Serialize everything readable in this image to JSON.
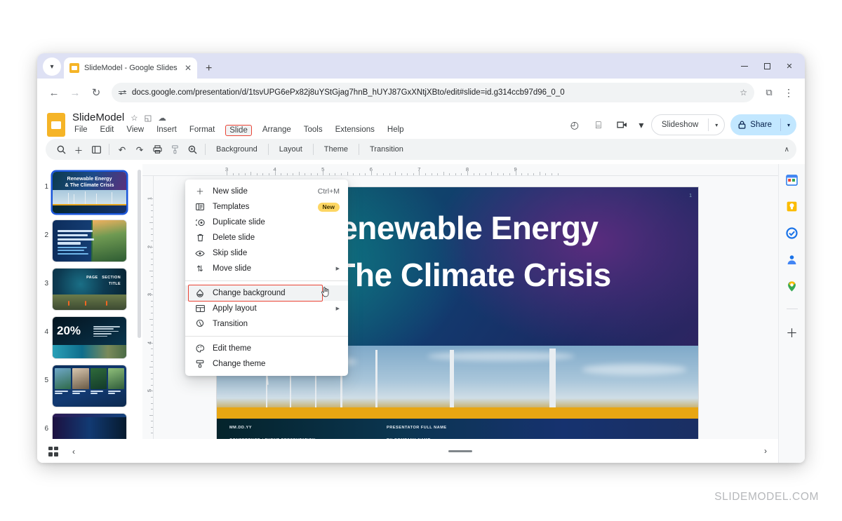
{
  "browser": {
    "tab": {
      "title": "SlideModel - Google Slides",
      "close_label": "✕",
      "newtab_label": "+"
    },
    "tab_list_chevron": "▾",
    "window_controls": {
      "minimize": "—",
      "maximize": "❐",
      "close": "✕"
    },
    "nav": {
      "back": "←",
      "forward": "→",
      "reload": "↻"
    },
    "url": "docs.google.com/presentation/d/1tsvUPG6ePx82j8uYStGjag7hnB_hUYJ87GxXNtjXBto/edit#slide=id.g314ccb97d96_0_0",
    "bookmark_star": "☆",
    "extensions": "⧉",
    "menu_kebab": "⋮"
  },
  "app": {
    "doc_title": "SlideModel",
    "title_icons": [
      "star-icon",
      "move-to-folder-icon",
      "cloud-saved-icon"
    ],
    "title_icon_glyphs": [
      "☆",
      "◱",
      "☁"
    ],
    "menubar": [
      "File",
      "Edit",
      "View",
      "Insert",
      "Format",
      "Slide",
      "Arrange",
      "Tools",
      "Extensions",
      "Help"
    ],
    "active_menu": "Slide",
    "header_right": {
      "version_history": "◴",
      "comments": "⌸",
      "meet": "▷",
      "meet_caret": "▾",
      "slideshow_label": "Slideshow",
      "slideshow_caret": "▾",
      "share_label": "Share",
      "share_lock": "⚿",
      "share_caret": "▾"
    },
    "toolbar": {
      "icons": [
        "search-icon",
        "add-slide-icon",
        "layout-icon",
        "undo-icon",
        "redo-icon",
        "print-icon",
        "paint-format-icon",
        "zoom-icon"
      ],
      "icon_glyphs": [
        "⌕",
        "＋",
        "▤",
        "↶",
        "↷",
        "⎙",
        "✒",
        "⌕"
      ],
      "text_items": [
        "Background",
        "Layout",
        "Theme",
        "Transition"
      ],
      "collapse": "∧"
    }
  },
  "menu": {
    "items": [
      {
        "icon": "plus-icon",
        "glyph": "＋",
        "label": "New slide",
        "shortcut": "Ctrl+M"
      },
      {
        "icon": "templates-icon",
        "glyph": "▤",
        "label": "Templates",
        "badge": "New"
      },
      {
        "icon": "duplicate-icon",
        "glyph": "◎",
        "label": "Duplicate slide"
      },
      {
        "icon": "trash-icon",
        "glyph": "Ὕ1",
        "label": "Delete slide"
      },
      {
        "icon": "eye-icon",
        "glyph": "◉",
        "label": "Skip slide"
      },
      {
        "icon": "move-icon",
        "glyph": "⇅",
        "label": "Move slide",
        "submenu": "▶"
      },
      {
        "separator": true
      },
      {
        "icon": "background-icon",
        "glyph": "☂",
        "label": "Change background",
        "highlighted": true,
        "cursor": "☝"
      },
      {
        "icon": "layout-icon",
        "glyph": "▤",
        "label": "Apply layout",
        "submenu": "▶"
      },
      {
        "icon": "transition-icon",
        "glyph": "◱",
        "label": "Transition"
      },
      {
        "separator": true
      },
      {
        "icon": "palette-icon",
        "glyph": "◔",
        "label": "Edit theme"
      },
      {
        "icon": "brush-icon",
        "glyph": "⚒",
        "label": "Change theme"
      }
    ]
  },
  "filmstrip": {
    "slides": [
      {
        "num": "1",
        "selected": true,
        "title": "Renewable Energy\n& The Climate Crisis"
      },
      {
        "num": "2",
        "selected": false,
        "title": "LOREM IPSUM DOLOR SIT AMET CONSECTETUR 30% BY YYYY"
      },
      {
        "num": "3",
        "selected": false,
        "title": "PAGE TITLE / SECTION"
      },
      {
        "num": "4",
        "selected": false,
        "title": "20%"
      },
      {
        "num": "5",
        "selected": false,
        "title": "IMAGE CAPTIONS"
      },
      {
        "num": "6",
        "selected": false,
        "title": ""
      }
    ],
    "bottom": {
      "grid_view": "grid-view-icon",
      "collapse": "‹"
    }
  },
  "canvas": {
    "ruler_h_numbers": [
      "3",
      "4",
      "5",
      "6",
      "7",
      "8",
      "9"
    ],
    "ruler_v_numbers": [
      "1",
      "2",
      "3",
      "4",
      "5"
    ],
    "slide_page_number": "1",
    "slide": {
      "title_line1": "Renewable Energy",
      "title_line2": "& The Climate Crisis",
      "footer_date": "MM.DD.YY",
      "footer_event": "CONFERENCE / EVENT PRESENTATION",
      "footer_presenter": "PRESENTATOR FULL NAME",
      "footer_company": "BY COMPANY NAME"
    },
    "bottom": {
      "next_arrow": "›"
    }
  },
  "rail": {
    "icons": [
      "calendar-icon",
      "keep-icon",
      "tasks-icon",
      "contacts-icon",
      "maps-icon"
    ],
    "glyphs": [
      "31",
      "■",
      "✓",
      "☺",
      "◉"
    ],
    "add": "＋"
  },
  "watermark": "SLIDEMODEL.COM",
  "colors": {
    "accent_red": "#ea4335",
    "google_blue": "#1a73e8",
    "share_bg": "#c2e7ff",
    "tab_strip": "#dee1f4",
    "slides_yellow": "#f5b427"
  }
}
